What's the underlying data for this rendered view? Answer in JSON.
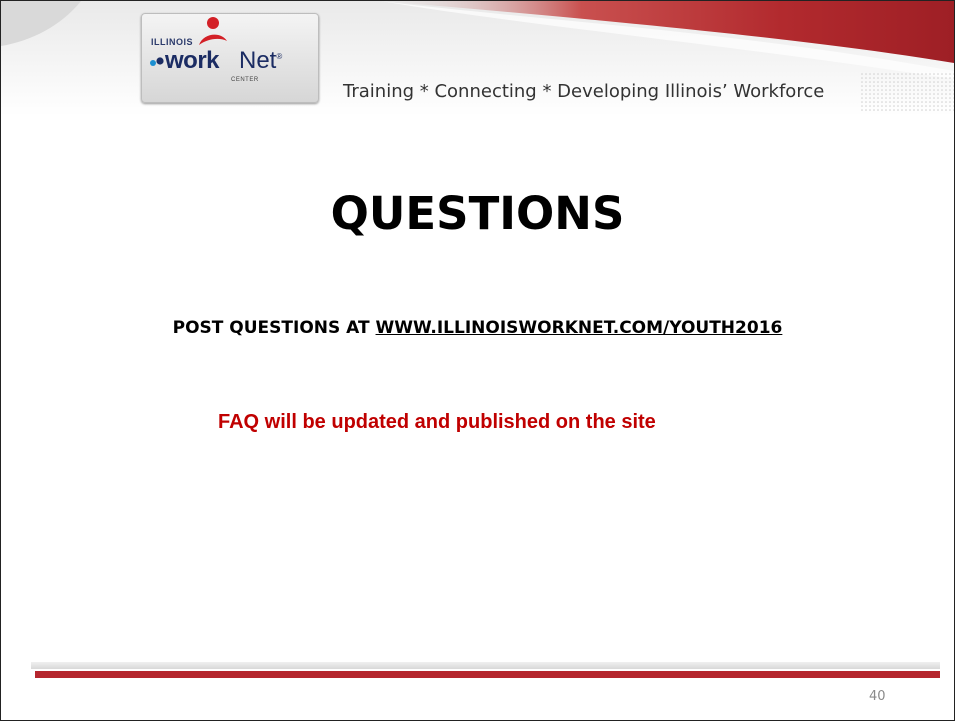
{
  "header": {
    "logo": {
      "state": "ILLINOIS",
      "work": "work",
      "net": "Net",
      "trademark": "®",
      "center": "CENTER"
    },
    "tagline": "Training * Connecting * Developing Illinois’ Workforce"
  },
  "main": {
    "title": "QUESTIONS",
    "post_prefix": "POST QUESTIONS AT ",
    "post_link": "WWW.ILLINOISWORKNET.COM/YOUTH2016",
    "faq_note": "FAQ will be updated and published on the site"
  },
  "footer": {
    "page_number": "40"
  },
  "colors": {
    "accent_red": "#b5262e",
    "faq_red": "#c00000",
    "logo_navy": "#1b2c63"
  }
}
